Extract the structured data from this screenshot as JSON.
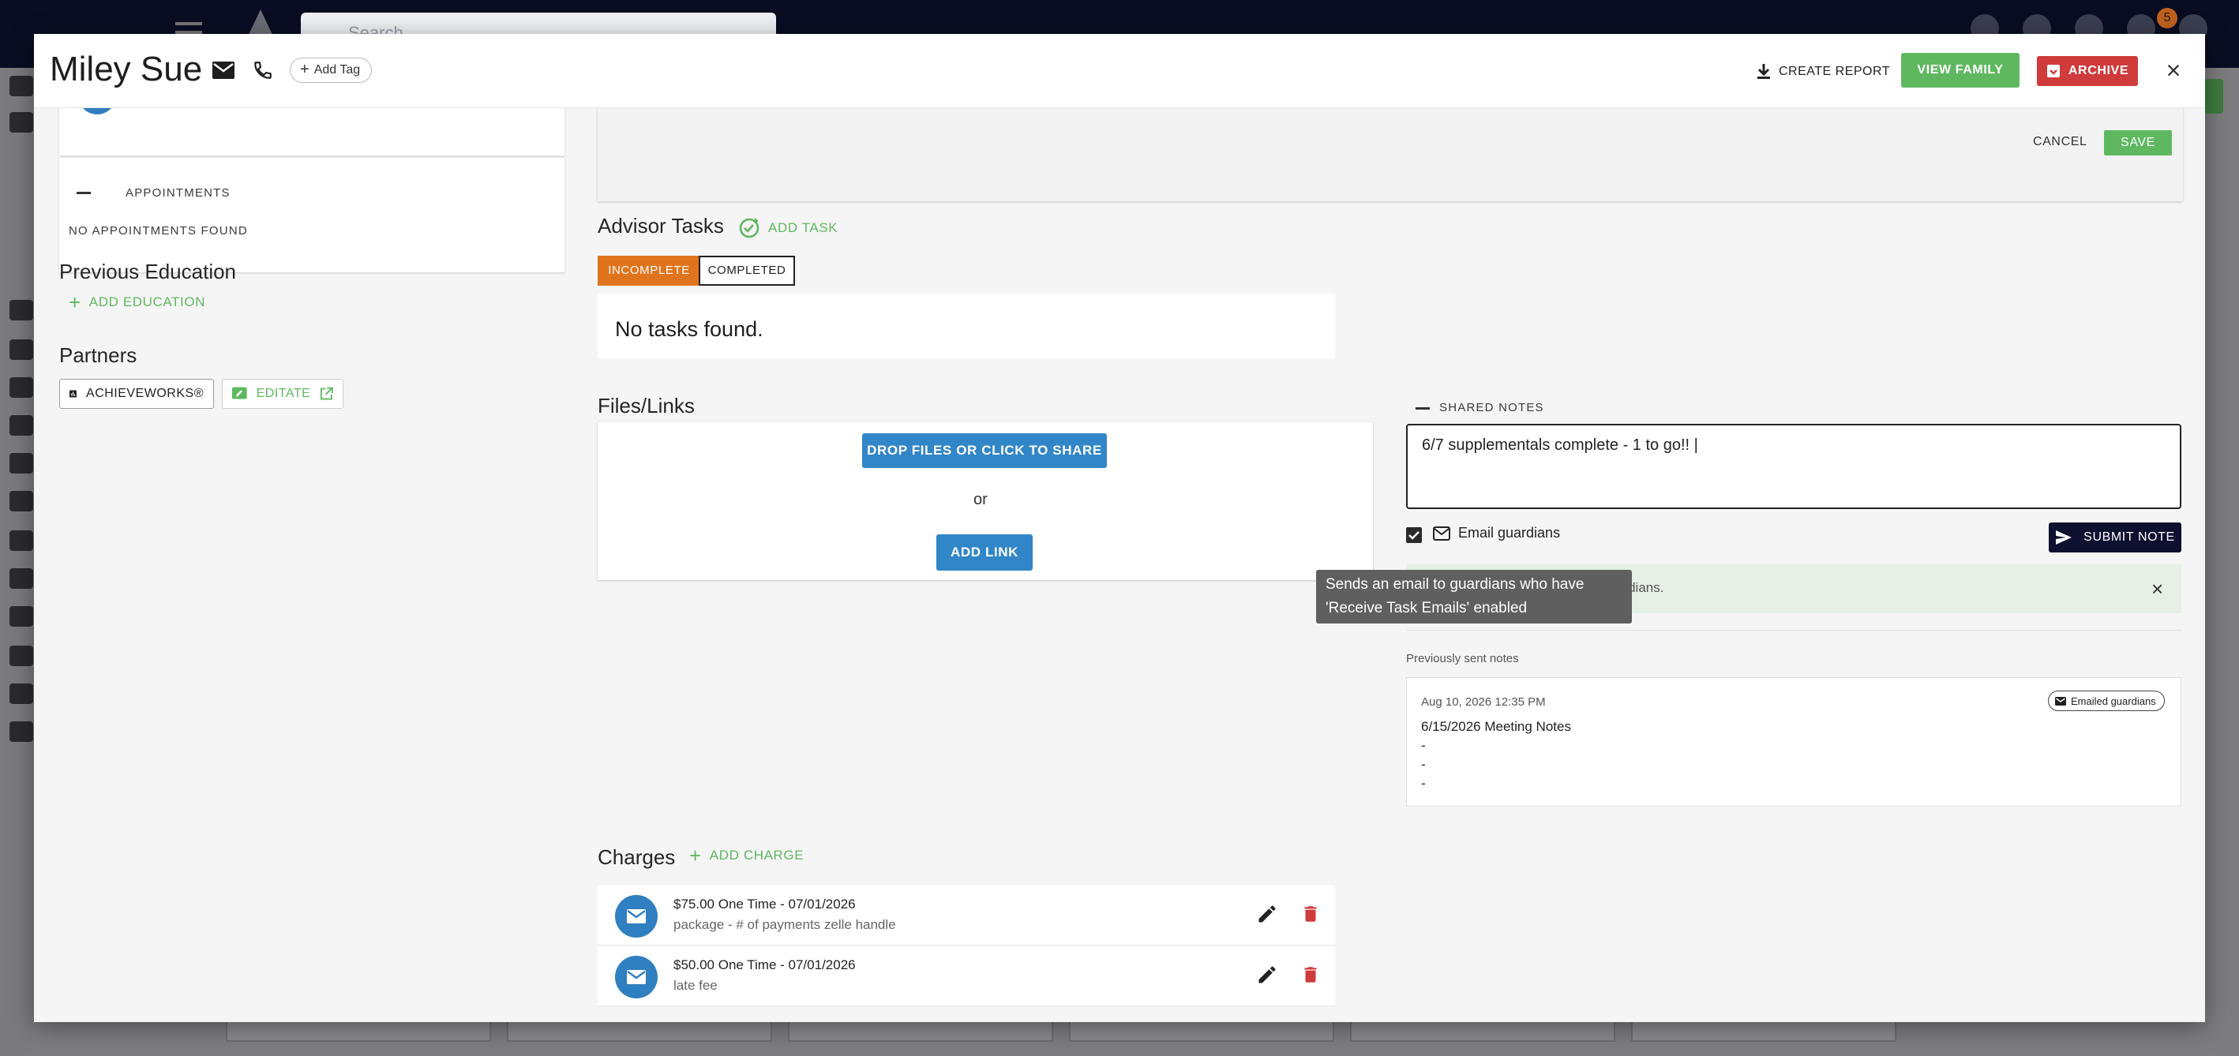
{
  "background": {
    "search_placeholder": "Search",
    "notification_count": "5"
  },
  "header": {
    "student_name": "Miley Sue",
    "add_tag_label": "Add Tag",
    "create_report_label": "CREATE REPORT",
    "view_family_label": "VIEW FAMILY",
    "archive_label": "ARCHIVE"
  },
  "left": {
    "appointments_label": "APPOINTMENTS",
    "no_appointments": "NO APPOINTMENTS FOUND",
    "previous_education_title": "Previous Education",
    "add_education_label": "ADD EDUCATION",
    "partners_title": "Partners",
    "partners": [
      {
        "label": "ACHIEVEWORKS®"
      },
      {
        "label": "EDITATE"
      }
    ]
  },
  "top_panel": {
    "cancel_label": "CANCEL",
    "save_label": "SAVE"
  },
  "tasks": {
    "title": "Advisor Tasks",
    "add_task_label": "ADD TASK",
    "filters": [
      "INCOMPLETE",
      "COMPLETED"
    ],
    "active_filter": "INCOMPLETE",
    "empty_text": "No tasks found."
  },
  "files": {
    "title": "Files/Links",
    "drop_label": "DROP FILES OR CLICK TO SHARE",
    "or_text": "or",
    "add_link_label": "ADD LINK"
  },
  "notes": {
    "section_label": "SHARED NOTES",
    "current_text": "6/7 supplementals complete - 1 to go!! |",
    "email_guardians_label": "Email guardians",
    "email_guardians_checked": true,
    "submit_label": "SUBMIT NOTE",
    "alert_text": "d to guardians.",
    "tooltip_text": "Sends an email to guardians who have 'Receive Task Emails' enabled",
    "previous_label": "Previously sent notes",
    "previous": [
      {
        "date": "Aug 10, 2026 12:35 PM",
        "chip": "Emailed guardians",
        "body": "6/15/2026 Meeting Notes\n-\n-\n-"
      }
    ]
  },
  "charges": {
    "title": "Charges",
    "add_label": "ADD CHARGE",
    "items": [
      {
        "main": "$75.00 One Time - 07/01/2026",
        "sub": "package - # of payments zelle handle"
      },
      {
        "main": "$50.00 One Time - 07/01/2026",
        "sub": "late fee"
      }
    ]
  },
  "colors": {
    "green": "#5fb860",
    "orange": "#e0741c",
    "red": "#cf3b3b",
    "blue": "#3186c8",
    "navy": "#0e1030"
  }
}
